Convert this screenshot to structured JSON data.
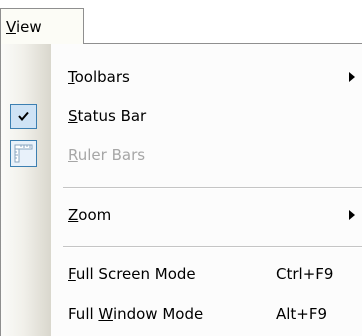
{
  "menu": {
    "title": "View"
  },
  "items": [
    {
      "label": "Toolbars",
      "mnemonic_index": 0,
      "submenu": true,
      "enabled": true
    },
    {
      "label": "Status Bar",
      "mnemonic_index": 0,
      "checked": true,
      "enabled": true
    },
    {
      "label": "Ruler Bars",
      "mnemonic_index": 0,
      "enabled": false,
      "icon": "ruler-icon"
    },
    {
      "label": "Zoom",
      "mnemonic_index": 0,
      "submenu": true,
      "enabled": true
    },
    {
      "label": "Full Screen Mode",
      "mnemonic_index": 0,
      "shortcut": "Ctrl+F9",
      "enabled": true
    },
    {
      "label": "Full Window Mode",
      "mnemonic_index": 5,
      "shortcut": "Alt+F9",
      "enabled": true
    }
  ],
  "icons": {
    "check": "check-icon",
    "ruler": "ruler-icon",
    "submenu": "chevron-right-icon"
  },
  "colors": {
    "highlight_border": "#3c7fb1",
    "highlight_fill": "#cfe3f5",
    "disabled_text": "#a6a6a6"
  }
}
